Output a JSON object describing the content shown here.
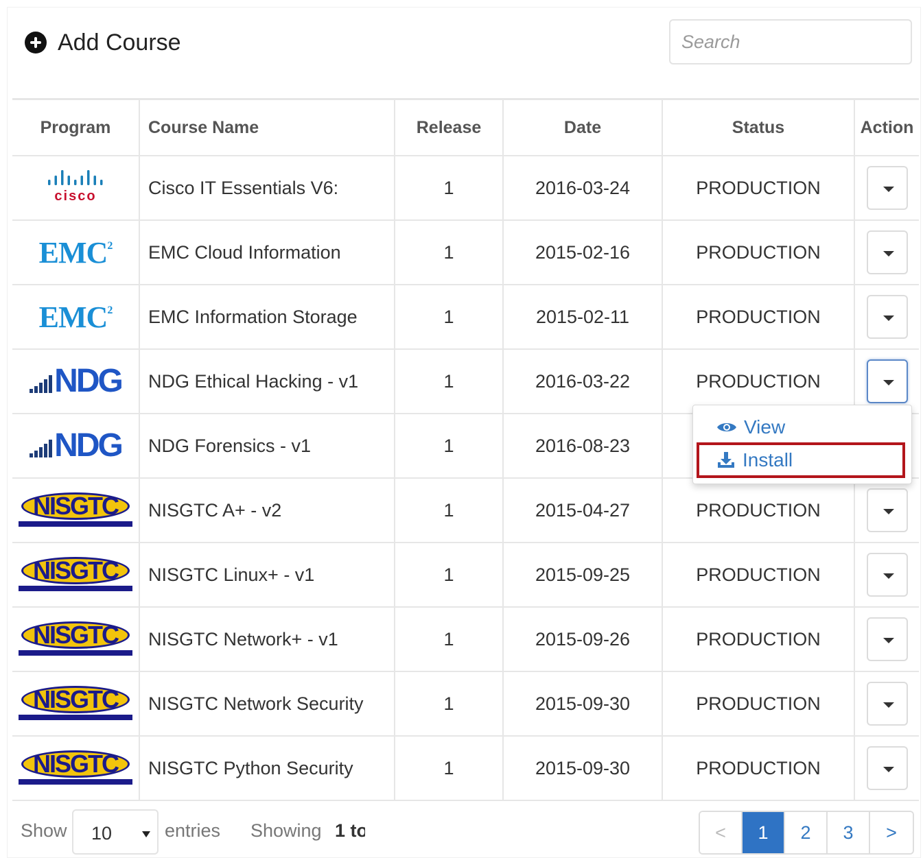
{
  "header": {
    "add_course_label": "Add Course",
    "search_placeholder": "Search"
  },
  "table": {
    "columns": [
      "Program",
      "Course Name",
      "Release",
      "Date",
      "Status",
      "Action"
    ],
    "rows": [
      {
        "program_logo": "cisco-logo",
        "logo_text": "cisco",
        "course_name": "Cisco IT Essentials V6:",
        "release": "1",
        "date": "2016-03-24",
        "status": "PRODUCTION"
      },
      {
        "program_logo": "emc-logo",
        "logo_text": "EMC",
        "course_name": "EMC Cloud Information",
        "release": "1",
        "date": "2015-02-16",
        "status": "PRODUCTION"
      },
      {
        "program_logo": "emc-logo",
        "logo_text": "EMC",
        "course_name": "EMC Information Storage",
        "release": "1",
        "date": "2015-02-11",
        "status": "PRODUCTION"
      },
      {
        "program_logo": "ndg-logo",
        "logo_text": "NDG",
        "course_name": "NDG Ethical Hacking - v1",
        "release": "1",
        "date": "2016-03-22",
        "status": "PRODUCTION"
      },
      {
        "program_logo": "ndg-logo",
        "logo_text": "NDG",
        "course_name": "NDG Forensics - v1",
        "release": "1",
        "date": "2016-08-23",
        "status": ""
      },
      {
        "program_logo": "nisgtc-logo",
        "logo_text": "NISGTC",
        "course_name": "NISGTC A+ - v2",
        "release": "1",
        "date": "2015-04-27",
        "status": "PRODUCTION"
      },
      {
        "program_logo": "nisgtc-logo",
        "logo_text": "NISGTC",
        "course_name": "NISGTC Linux+ - v1",
        "release": "1",
        "date": "2015-09-25",
        "status": "PRODUCTION"
      },
      {
        "program_logo": "nisgtc-logo",
        "logo_text": "NISGTC",
        "course_name": "NISGTC Network+ - v1",
        "release": "1",
        "date": "2015-09-26",
        "status": "PRODUCTION"
      },
      {
        "program_logo": "nisgtc-logo",
        "logo_text": "NISGTC",
        "course_name": "NISGTC Network Security",
        "release": "1",
        "date": "2015-09-30",
        "status": "PRODUCTION"
      },
      {
        "program_logo": "nisgtc-logo",
        "logo_text": "NISGTC",
        "course_name": "NISGTC Python Security",
        "release": "1",
        "date": "2015-09-30",
        "status": "PRODUCTION"
      }
    ]
  },
  "action_menu": {
    "open_row": 3,
    "items": [
      {
        "icon": "eye-icon",
        "label": "View"
      },
      {
        "icon": "download-icon",
        "label": "Install",
        "highlighted": true
      }
    ],
    "highlight_color": "#b3151b"
  },
  "footer": {
    "show_label": "Show",
    "page_length": "10",
    "entries_label": "entries",
    "showing_label": "Showing",
    "showing_range": "1 to",
    "pagination": {
      "prev": "<",
      "pages": [
        "1",
        "2",
        "3"
      ],
      "current": "1",
      "next": ">"
    }
  },
  "colors": {
    "accent": "#2f73c4",
    "link": "#3479c2"
  }
}
